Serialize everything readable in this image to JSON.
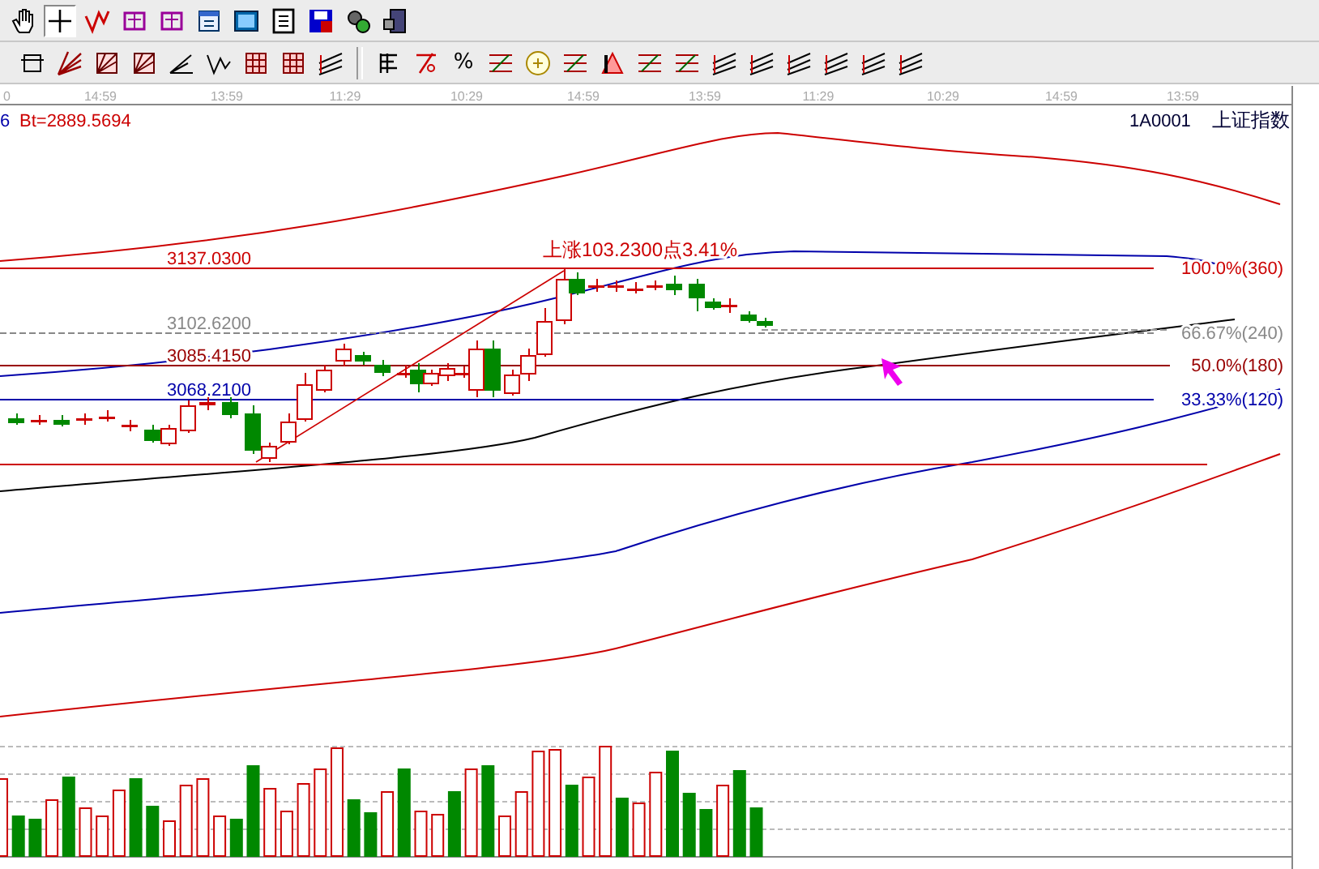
{
  "toolbars": [
    {
      "buttons": [
        {
          "kind": "hand",
          "selected": false
        },
        {
          "kind": "crosshair",
          "selected": true
        },
        {
          "kind": "polyline",
          "selected": false
        },
        {
          "kind": "stamp",
          "selected": false
        },
        {
          "kind": "stamp",
          "selected": false
        },
        {
          "kind": "calendar",
          "selected": false
        },
        {
          "kind": "picture",
          "selected": false
        },
        {
          "kind": "document",
          "selected": false
        },
        {
          "kind": "disk",
          "selected": false
        },
        {
          "kind": "gears",
          "selected": false
        },
        {
          "kind": "device",
          "selected": false
        }
      ]
    },
    {
      "buttons": [
        {
          "kind": "box-line",
          "selected": false
        },
        {
          "kind": "fan",
          "selected": false
        },
        {
          "kind": "box-fan",
          "selected": false
        },
        {
          "kind": "box-fan",
          "selected": false
        },
        {
          "kind": "angle",
          "selected": false
        },
        {
          "kind": "wave",
          "selected": false
        },
        {
          "kind": "grid",
          "selected": false
        },
        {
          "kind": "grid",
          "selected": false
        },
        {
          "kind": "parallel",
          "selected": false
        },
        {
          "kind": "separator",
          "selected": false
        },
        {
          "kind": "table",
          "selected": false
        },
        {
          "kind": "percent-slash",
          "selected": false
        },
        {
          "kind": "text",
          "label": "%",
          "selected": false
        },
        {
          "kind": "levels",
          "selected": false
        },
        {
          "kind": "coin",
          "selected": false
        },
        {
          "kind": "levels",
          "selected": false
        },
        {
          "kind": "triangle",
          "selected": false
        },
        {
          "kind": "levels",
          "selected": false
        },
        {
          "kind": "levels",
          "selected": false
        },
        {
          "kind": "parallel",
          "selected": false
        },
        {
          "kind": "parallel",
          "selected": false
        },
        {
          "kind": "parallel",
          "selected": false
        },
        {
          "kind": "parallel",
          "selected": false
        },
        {
          "kind": "parallel",
          "selected": false
        },
        {
          "kind": "parallel",
          "selected": false
        }
      ]
    }
  ],
  "time_axis": [
    "0",
    "14:59",
    "13:59",
    "11:29",
    "10:29",
    "14:59",
    "13:59",
    "11:29",
    "10:29",
    "14:59",
    "13:59"
  ],
  "info": {
    "period": "6",
    "base": "Bt=2889.5694",
    "code": "1A0001",
    "name": "上证指数"
  },
  "price_levels": [
    {
      "price": "3137.0300",
      "ratio": "100.0%(360)",
      "kind": "top"
    },
    {
      "price": "3102.6200",
      "ratio": "66.67%(240)",
      "kind": "faint"
    },
    {
      "price": "3085.4150",
      "ratio": "50.0%(180)",
      "kind": "mid"
    },
    {
      "price": "3068.2100",
      "ratio": "33.33%(120)",
      "kind": "low"
    }
  ],
  "change_label": "上涨103.2300点3.41%"
}
